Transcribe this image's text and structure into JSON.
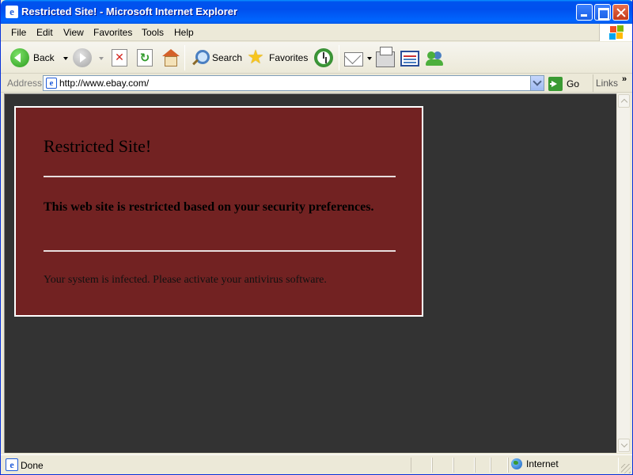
{
  "window": {
    "title": "Restricted Site! - Microsoft Internet Explorer",
    "app_icon": "ie-icon"
  },
  "menu": {
    "file": "File",
    "edit": "Edit",
    "view": "View",
    "favorites": "Favorites",
    "tools": "Tools",
    "help": "Help"
  },
  "toolbar": {
    "back": "Back",
    "search": "Search",
    "favorites": "Favorites"
  },
  "address": {
    "label": "Address",
    "url": "http://www.ebay.com/",
    "go": "Go",
    "links": "Links",
    "links_chevron": "»"
  },
  "page": {
    "title": "Restricted Site!",
    "heading": "This web site is restricted based on your security preferences.",
    "message": "Your system is infected. Please activate your antivirus software.",
    "box_color": "#722222",
    "background_color": "#333333"
  },
  "status": {
    "text": "Done",
    "zone": "Internet"
  }
}
